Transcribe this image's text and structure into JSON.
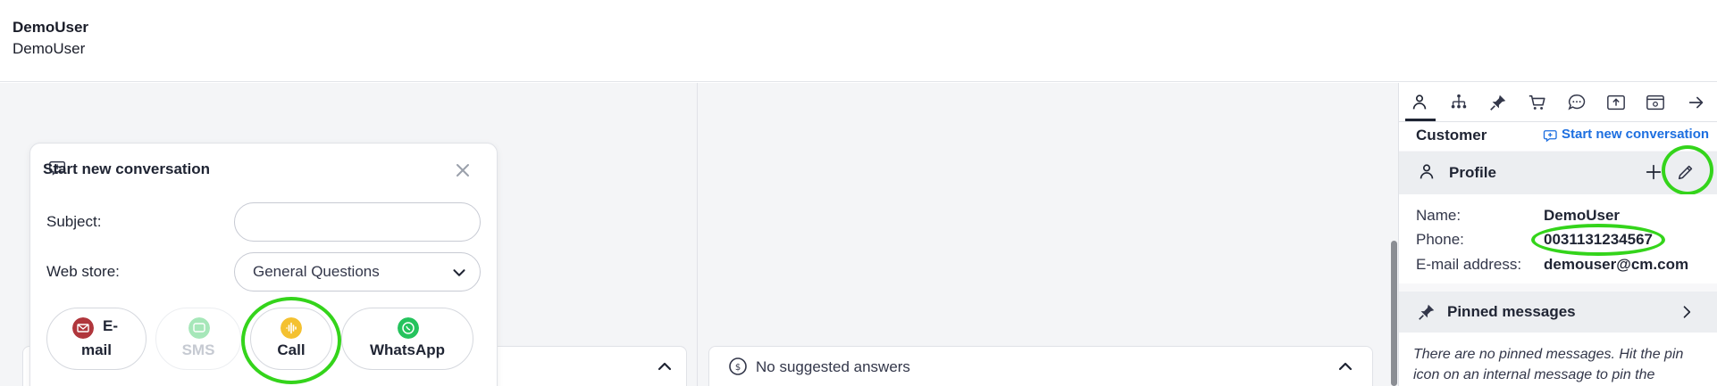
{
  "header": {
    "user_name": "DemoUser",
    "user_subtitle": "DemoUser"
  },
  "conversation_panel": {
    "title": "Start new conversation",
    "subject_label": "Subject:",
    "subject_value": "",
    "webstore_label": "Web store:",
    "webstore_value": "General Questions",
    "channels": [
      {
        "label_line1": "E-",
        "label_line2": "mail",
        "icon": "email-icon",
        "color": "#b0363c",
        "enabled": true
      },
      {
        "label": "SMS",
        "icon": "sms-icon",
        "color": "#a6e7b9",
        "enabled": false
      },
      {
        "label": "Call",
        "icon": "call-icon",
        "color": "#f4c130",
        "enabled": true,
        "highlighted": true
      },
      {
        "label": "WhatsApp",
        "icon": "whatsapp-icon",
        "color": "#25c35d",
        "enabled": true
      }
    ]
  },
  "suggestions": {
    "text": "No suggested answers"
  },
  "sidebar": {
    "tabs": [
      "person-icon",
      "hierarchy-icon",
      "pin-icon",
      "cart-icon",
      "chat-icon",
      "upload-icon",
      "browser-icon",
      "arrow-right-icon"
    ],
    "active_tab": "person-icon",
    "customer_title": "Customer",
    "start_link": "Start new conversation",
    "profile": {
      "title": "Profile",
      "fields": [
        {
          "label": "Name:",
          "value": "DemoUser"
        },
        {
          "label": "Phone:",
          "value": "0031131234567"
        },
        {
          "label": "E-mail address:",
          "value": "demouser@cm.com"
        }
      ]
    },
    "pinned": {
      "title": "Pinned messages",
      "empty_text": "There are no pinned messages. Hit the pin icon on an internal message to pin the"
    }
  },
  "colors": {
    "accent_link": "#1d6fe0",
    "highlight_ring": "#34d41b"
  }
}
